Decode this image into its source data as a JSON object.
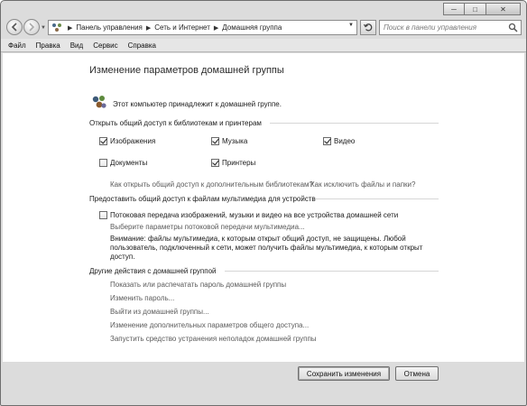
{
  "window": {
    "caption_buttons": {
      "minimize": "─",
      "maximize": "□",
      "close": "✕"
    }
  },
  "nav": {
    "back_icon": "arrow-left-icon",
    "forward_icon": "arrow-right-icon",
    "breadcrumb": [
      "Панель управления",
      "Сеть и Интернет",
      "Домашняя группа"
    ],
    "search_placeholder": "Поиск в панели управления"
  },
  "menu": [
    "Файл",
    "Правка",
    "Вид",
    "Сервис",
    "Справка"
  ],
  "page": {
    "title": "Изменение параметров домашней группы",
    "membership_text": "Этот компьютер принадлежит к домашней группе."
  },
  "share_section": {
    "heading": "Открыть общий доступ к библиотекам и принтерам",
    "items": [
      {
        "label": "Изображения",
        "checked": true
      },
      {
        "label": "Музыка",
        "checked": true
      },
      {
        "label": "Видео",
        "checked": true
      },
      {
        "label": "Документы",
        "checked": false
      },
      {
        "label": "Принтеры",
        "checked": true
      }
    ],
    "link_more_libraries": "Как открыть общий доступ к дополнительным библиотекам?",
    "link_exclude": "Как исключить файлы и папки?"
  },
  "media_section": {
    "heading": "Предоставить общий доступ к файлам мультимедиа для устройств",
    "stream_label": "Потоковая передача изображений, музыки и видео на все устройства домашней сети",
    "stream_checked": false,
    "stream_options_link": "Выберите параметры потоковой передачи мультимедиа...",
    "warning": "Внимание: файлы мультимедиа, к которым открыт общий доступ, не защищены. Любой пользователь, подключенный к сети, может получить файлы мультимедиа, к которым открыт доступ."
  },
  "other_section": {
    "heading": "Другие действия с домашней группой",
    "links": [
      "Показать или распечатать пароль домашней группы",
      "Изменить пароль...",
      "Выйти из домашней группы...",
      "Изменение дополнительных параметров общего доступа...",
      "Запустить средство устранения неполадок домашней группы"
    ]
  },
  "footer": {
    "save_label": "Сохранить изменения",
    "cancel_label": "Отмена"
  }
}
